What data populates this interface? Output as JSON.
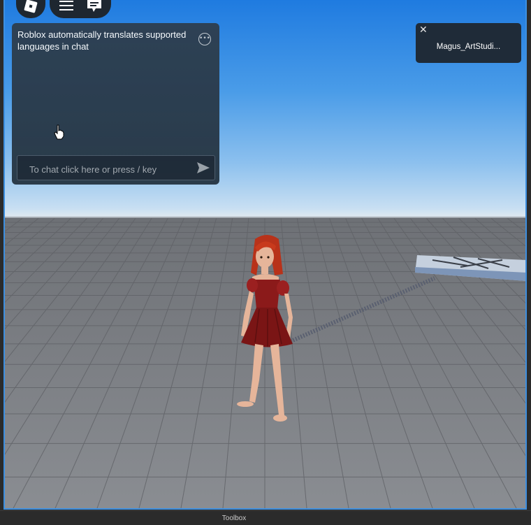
{
  "chat": {
    "system_message": "Roblox automatically translates supported languages in chat",
    "input_placeholder": "To chat click here or press / key"
  },
  "notification": {
    "username": "Magus_ArtStudi..."
  },
  "statusbar": {
    "panel_label": "Toolbox"
  },
  "icons": {
    "roblox_logo": "roblox-logo-icon",
    "menu": "hamburger-menu-icon",
    "chat_toggle": "chat-bubble-icon",
    "chat_options": "ellipsis-icon",
    "send": "send-arrow-icon",
    "close": "close-icon",
    "cursor": "hand-pointer-icon"
  },
  "colors": {
    "sky_top": "#1f7be0",
    "baseplate": "#7a7c80",
    "viewport_border": "#3d8fe0",
    "dress": "#8b1a1a",
    "hair": "#b8321a"
  }
}
